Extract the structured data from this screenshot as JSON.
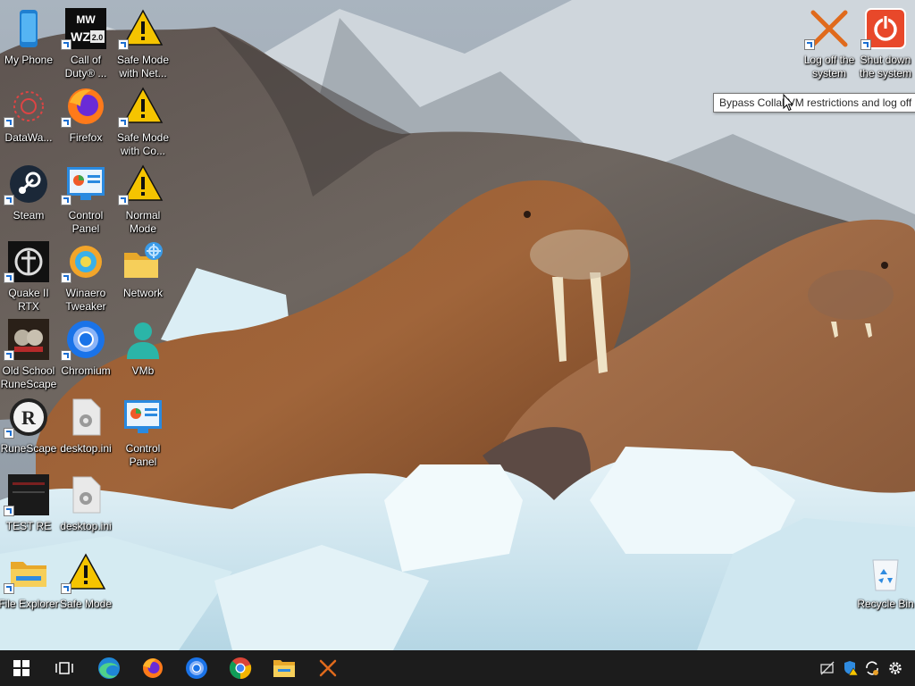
{
  "desktop": {
    "icons": [
      {
        "label": "My Phone",
        "icon": "phone-icon",
        "shortcut": false
      },
      {
        "label": "DataWa...",
        "icon": "datawave-icon",
        "shortcut": true
      },
      {
        "label": "Steam",
        "icon": "steam-icon",
        "shortcut": true
      },
      {
        "label": "Quake II RTX",
        "icon": "quake-icon",
        "shortcut": true
      },
      {
        "label": "Old School RuneScape",
        "icon": "osrs-icon",
        "shortcut": true
      },
      {
        "label": "RuneScape",
        "icon": "runescape-icon",
        "shortcut": true
      },
      {
        "label": "TEST RE",
        "icon": "test-re-icon",
        "shortcut": true
      },
      {
        "label": "File Explorer",
        "icon": "folder-icon",
        "shortcut": true
      },
      {
        "label": "Call of Duty® ...",
        "icon": "call-of-duty-icon",
        "shortcut": true
      },
      {
        "label": "Firefox",
        "icon": "firefox-icon",
        "shortcut": true
      },
      {
        "label": "Control Panel",
        "icon": "control-panel-icon",
        "shortcut": true
      },
      {
        "label": "Winaero Tweaker",
        "icon": "winaero-icon",
        "shortcut": true
      },
      {
        "label": "Chromium",
        "icon": "chromium-icon",
        "shortcut": true
      },
      {
        "label": "desktop.ini",
        "icon": "ini-file-icon",
        "shortcut": false
      },
      {
        "label": "desktop.ini",
        "icon": "ini-file-icon",
        "shortcut": false
      },
      {
        "label": "Safe Mode",
        "icon": "warning-icon",
        "shortcut": true
      },
      {
        "label": "Safe Mode with Net...",
        "icon": "warning-icon",
        "shortcut": true
      },
      {
        "label": "Safe Mode with Co...",
        "icon": "warning-icon",
        "shortcut": true
      },
      {
        "label": "Normal Mode",
        "icon": "warning-icon",
        "shortcut": true
      },
      {
        "label": "Network",
        "icon": "network-icon",
        "shortcut": false
      },
      {
        "label": "VMb",
        "icon": "user-icon",
        "shortcut": false
      },
      {
        "label": "Control Panel",
        "icon": "control-panel-icon",
        "shortcut": false
      },
      {
        "label": "Log off the system",
        "icon": "log-off-icon",
        "shortcut": true
      },
      {
        "label": "Shut down the system",
        "icon": "power-icon",
        "shortcut": true
      },
      {
        "label": "Recycle Bin",
        "icon": "recycle-bin-icon",
        "shortcut": false
      }
    ]
  },
  "tooltip": {
    "text": "Bypass CollabVM restrictions and log off"
  },
  "taskbar": {
    "buttons": [
      {
        "name": "start-button",
        "icon": "windows-logo-icon"
      },
      {
        "name": "task-view-button",
        "icon": "task-view-icon"
      },
      {
        "name": "edge-button",
        "icon": "edge-icon"
      },
      {
        "name": "firefox-button",
        "icon": "firefox-icon"
      },
      {
        "name": "chromium-button",
        "icon": "chromium-icon"
      },
      {
        "name": "chrome-button",
        "icon": "chrome-icon"
      },
      {
        "name": "file-explorer-button",
        "icon": "folder-icon"
      },
      {
        "name": "log-off-button",
        "icon": "log-off-icon"
      }
    ],
    "tray": [
      {
        "name": "network-disconnected-icon"
      },
      {
        "name": "security-warning-icon"
      },
      {
        "name": "sync-icon"
      },
      {
        "name": "settings-icon"
      }
    ]
  },
  "colors": {
    "taskbar": "#1c1c1c",
    "tooltip_bg": "#ffffff",
    "accent": "#1c6fd2",
    "warning": "#f5c400",
    "log_off_x": "#e06a1c"
  }
}
